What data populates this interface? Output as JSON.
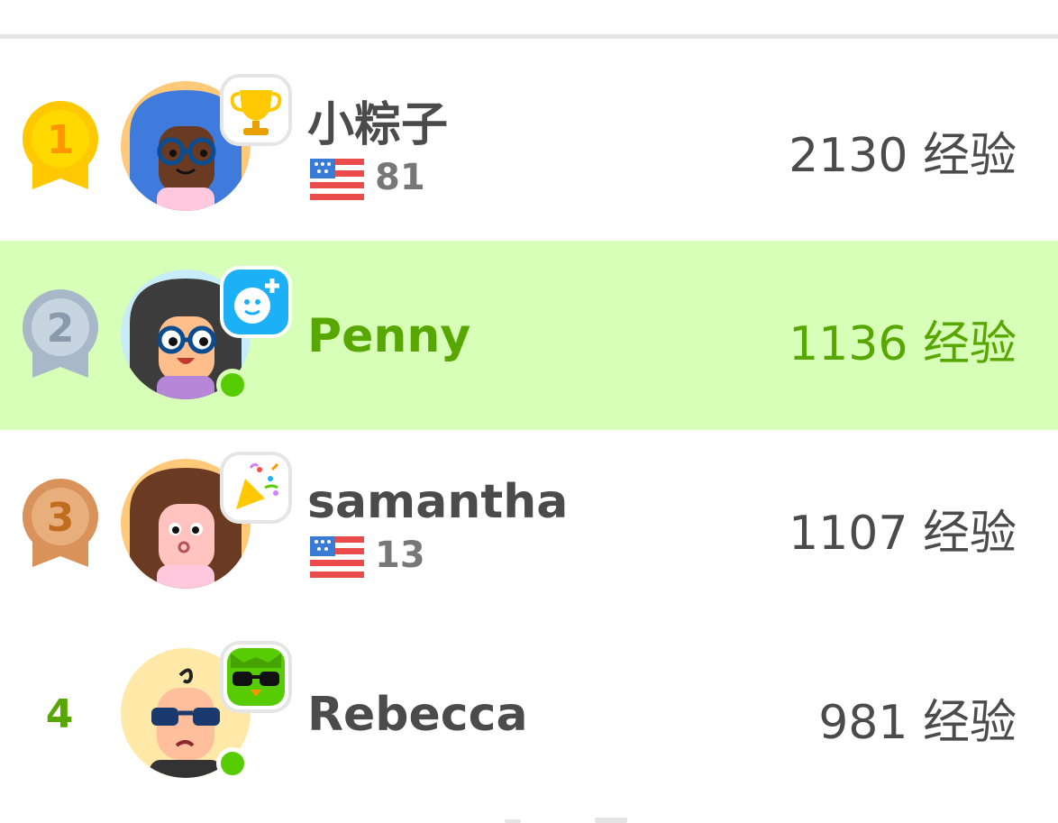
{
  "leaderboard": {
    "rows": [
      {
        "rank": "1",
        "name": "小粽子",
        "country_count": "81",
        "xp": "2130",
        "xp_unit": "经验"
      },
      {
        "rank": "2",
        "name": "Penny",
        "xp": "1136",
        "xp_unit": "经验"
      },
      {
        "rank": "3",
        "name": "samantha",
        "country_count": "13",
        "xp": "1107",
        "xp_unit": "经验"
      },
      {
        "rank": "4",
        "name": "Rebecca",
        "xp": "981",
        "xp_unit": "经验"
      }
    ]
  },
  "colors": {
    "current_user_bg": "#d7ffb8",
    "current_user_text": "#58a700",
    "gold": "#ffc800",
    "silver": "#a8b8c8",
    "bronze": "#d9935a",
    "online": "#58cc02"
  },
  "icons": {
    "rank_1": "gold-medal-icon",
    "rank_2": "silver-medal-icon",
    "rank_3": "bronze-medal-icon",
    "row_1_badge": "trophy-icon",
    "row_2_badge": "add-friend-smiley-icon",
    "row_3_badge": "party-popper-icon",
    "row_4_badge": "duo-sunglasses-icon",
    "flag": "us-flag-icon"
  }
}
